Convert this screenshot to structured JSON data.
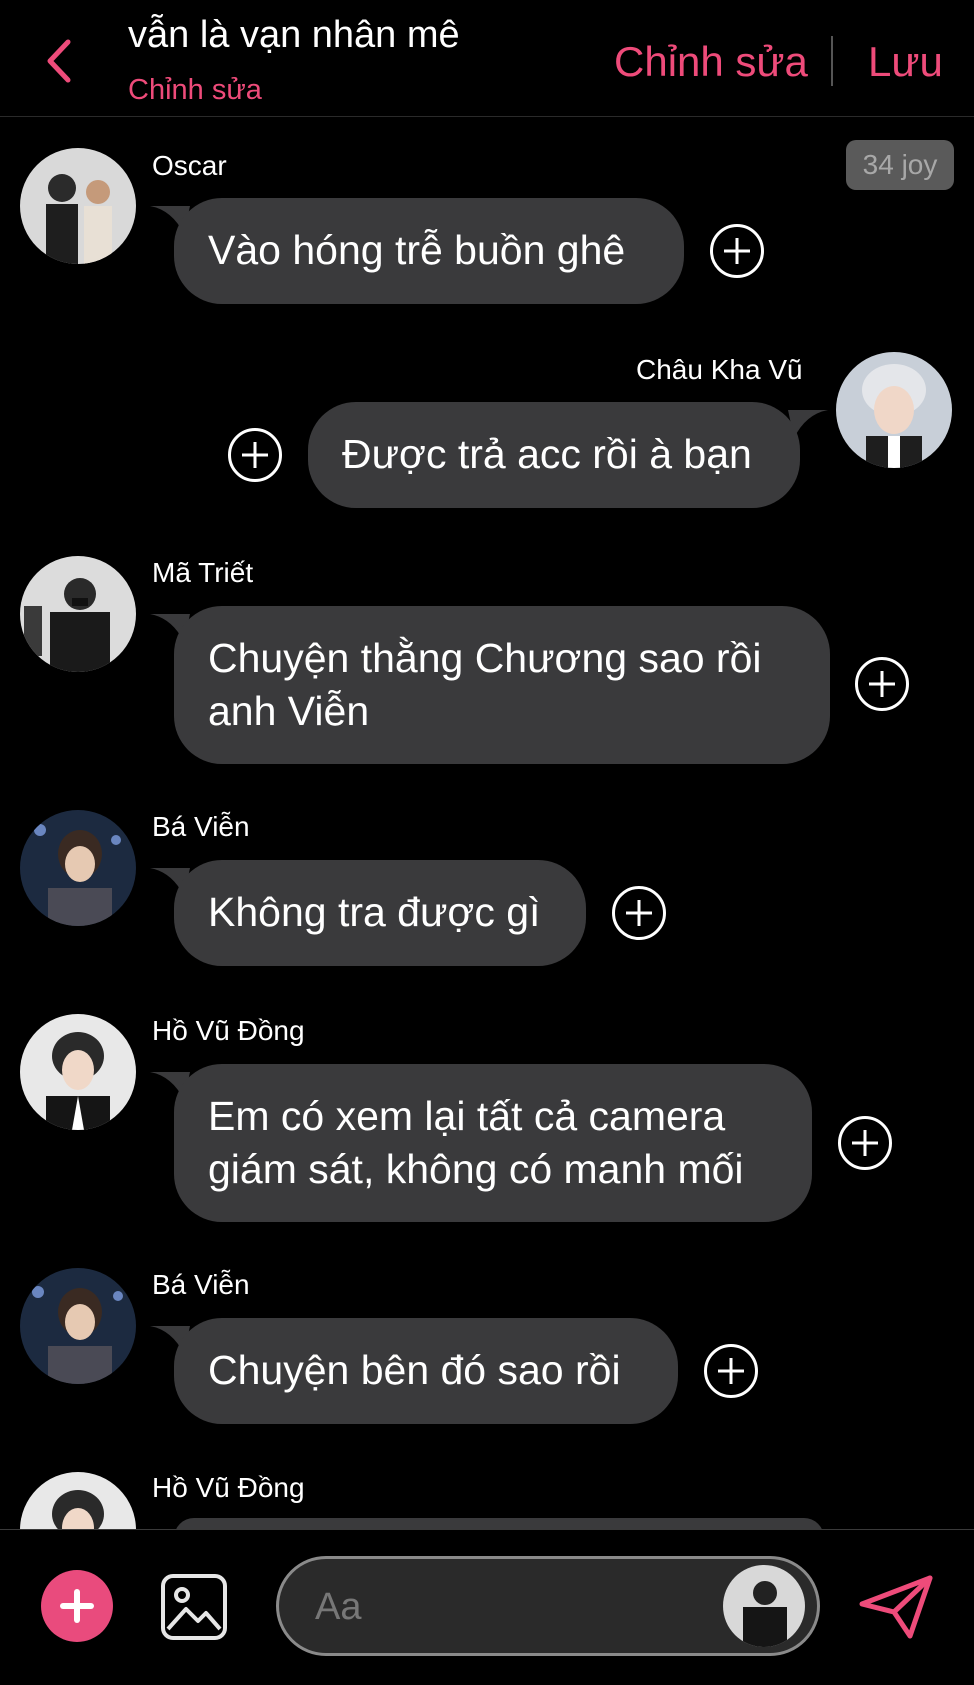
{
  "header": {
    "title": "vẫn là vạn nhân mê",
    "subtitle": "Chỉnh sửa",
    "edit_label": "Chỉnh sửa",
    "save_label": "Lưu"
  },
  "badge": "34 joy",
  "messages": [
    {
      "sender": "Oscar",
      "text_lines": [
        "Vào hóng trễ buồn ghê"
      ],
      "side": "left"
    },
    {
      "sender": "Châu Kha Vũ",
      "text_lines": [
        "Được trả acc rồi à bạn"
      ],
      "side": "right"
    },
    {
      "sender": "Mã Triết",
      "text_lines": [
        "Chuyện thằng Chương sao rồi",
        "anh Viễn"
      ],
      "side": "left"
    },
    {
      "sender": "Bá Viễn",
      "text_lines": [
        "Không tra được gì"
      ],
      "side": "left"
    },
    {
      "sender": "Hồ Vũ Đồng",
      "text_lines": [
        "Em có xem lại tất cả camera",
        "giám sát, không có manh mối"
      ],
      "side": "left"
    },
    {
      "sender": "Bá Viễn",
      "text_lines": [
        "Chuyện bên đó sao rồi"
      ],
      "side": "left"
    },
    {
      "sender": "Hồ Vũ Đồng",
      "text_lines": [],
      "side": "left"
    }
  ],
  "composer": {
    "placeholder": "Aa"
  },
  "colors": {
    "accent": "#ee4b7a",
    "bubble": "#3a3a3c",
    "background": "#000000"
  },
  "icons": {
    "back": "chevron-left-icon",
    "add": "plus-icon",
    "image": "image-icon",
    "send": "send-icon",
    "react": "plus-circle-icon"
  }
}
